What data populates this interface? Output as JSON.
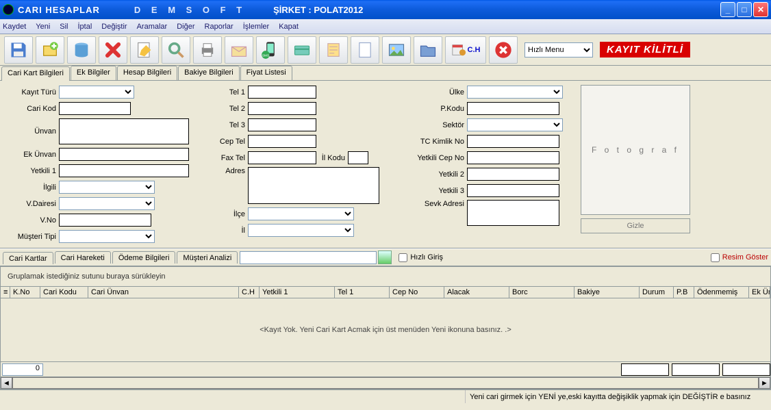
{
  "title": {
    "t1": "CARI HESAPLAR",
    "t2": "D E M S O F T",
    "t3": "ŞİRKET : POLAT2012"
  },
  "menu": {
    "kaydet": "Kaydet",
    "yeni": "Yeni",
    "sil": "Sil",
    "iptal": "İptal",
    "degistir": "Değiştir",
    "aramalar": "Aramalar",
    "diger": "Diğer",
    "raporlar": "Raporlar",
    "islemler": "İşlemler",
    "kapat": "Kapat"
  },
  "toolbar": {
    "quickmenu": "Hızlı Menu",
    "chLabel": "C.H",
    "kilitli": "KAYIT KİLİTLİ"
  },
  "tabs1": {
    "t0": "Cari Kart Bilgileri",
    "t1": "Ek Bilgiler",
    "t2": "Hesap Bilgileri",
    "t3": "Bakiye Bilgileri",
    "t4": "Fiyat Listesi"
  },
  "form": {
    "kayitturu": "Kayıt Türü",
    "carikod": "Cari Kod",
    "unvan": "Ünvan",
    "ekunvan": "Ek Ünvan",
    "yetkili1": "Yetkili 1",
    "ilgili": "İlgili",
    "vdairesi": "V.Dairesi",
    "vno": "V.No",
    "musteritipi": "Müşteri Tipi",
    "tel1": "Tel 1",
    "tel2": "Tel 2",
    "tel3": "Tel 3",
    "ceptel": "Cep Tel",
    "faxtel": "Fax Tel",
    "ilkodu": "İl Kodu",
    "adres": "Adres",
    "ilce": "İlçe",
    "il": "İl",
    "ulke": "Ülke",
    "pkodu": "P.Kodu",
    "sektor": "Sektör",
    "tckimlik": "TC Kimlik No",
    "yetkilicep": "Yetkili Cep No",
    "yetkili2": "Yetkili 2",
    "yetkili3": "Yetkili 3",
    "sevkadresi": "Sevk Adresi",
    "fotograf": "F o t o g r a f",
    "gizle": "Gizle"
  },
  "tabs2": {
    "t0": "Cari Kartlar",
    "t1": "Cari Hareketi",
    "t2": "Ödeme Bilgileri",
    "t3": "Müşteri Analizi"
  },
  "grid": {
    "hizligiris": "Hızlı Giriş",
    "resimgoster": "Resim Göster",
    "grouphint": "Gruplamak istediğiniz sutunu buraya sürükleyin",
    "cols": {
      "kno": "K.No",
      "carikodu": "Cari Kodu",
      "cariunvan": "Cari Ünvan",
      "ch": "C.H",
      "yetkili1": "Yetkili 1",
      "tel1": "Tel 1",
      "cepno": "Cep No",
      "alacak": "Alacak",
      "borc": "Borc",
      "bakiye": "Bakiye",
      "durum": "Durum",
      "pb": "P.B",
      "odenmemis": "Ödenmemiş",
      "ekunvan": "Ek Ünvan"
    },
    "empty": "<Kayıt Yok. Yeni Cari Kart Acmak için üst menüden Yeni ikonuna basınız. .>",
    "footer0": "0"
  },
  "status": "Yeni cari girmek için YENİ ye,eski kayıtta değişiklik yapmak için DEĞİŞTİR e basınız"
}
